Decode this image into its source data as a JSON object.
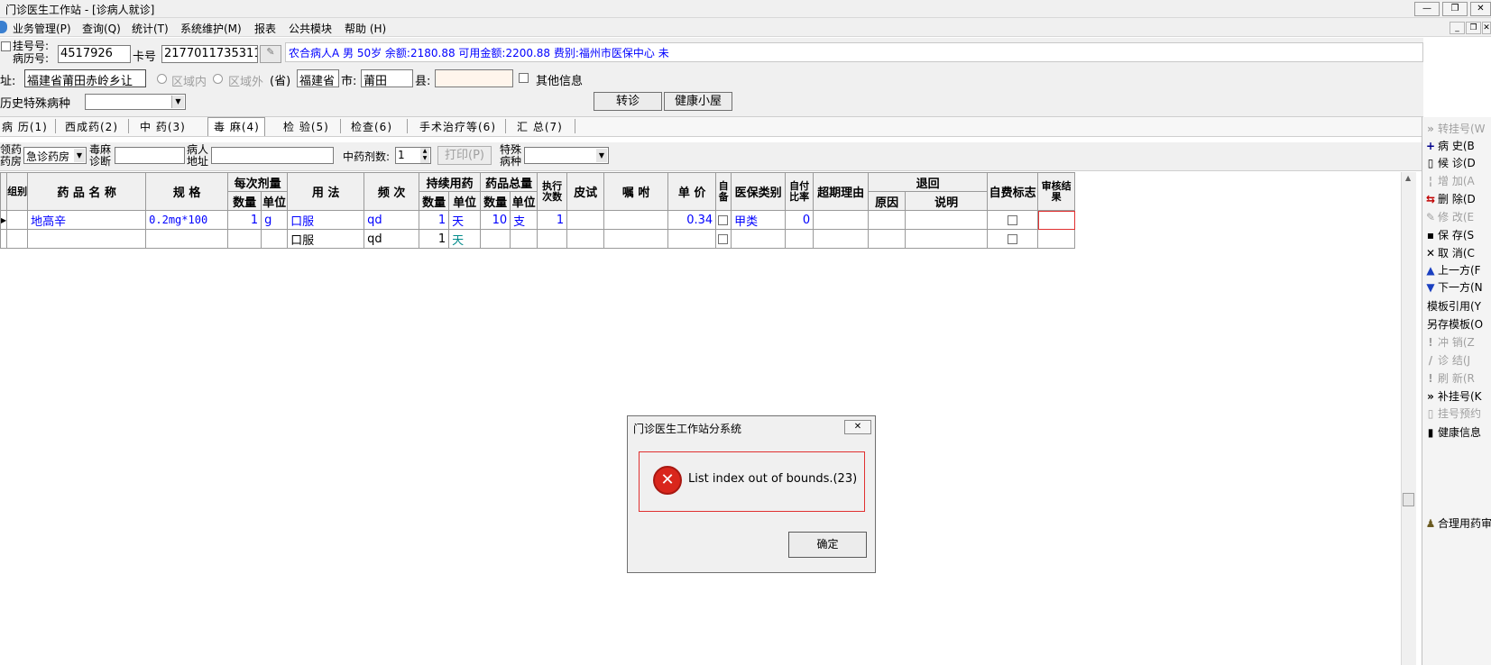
{
  "window": {
    "title": "门诊医生工作站 - [诊病人就诊]",
    "btn_min": "—",
    "btn_restore": "❐",
    "btn_close": "✕"
  },
  "menu": [
    "业务管理(P)",
    "查询(Q)",
    "统计(T)",
    "系统维护(M)",
    "报表",
    "公共模块",
    "帮助 (H)"
  ],
  "mdi": {
    "min": "_",
    "restore": "❐",
    "close": "✕"
  },
  "patient": {
    "reg_no_label": "挂号号:",
    "record_no_label": "病历号:",
    "reg_no": "4517926",
    "card_label": "卡号",
    "card_no": "2177011735311",
    "info": "农合病人A 男 50岁 余额:2180.88 可用金额:2200.88 费别:福州市医保中心 未",
    "addr_label": "址:",
    "addr": "福建省莆田赤岭乡让",
    "in_region": "区域内",
    "out_region": "区域外",
    "prov_label": "(省)",
    "province": "福建省",
    "city_label": "市:",
    "city": "莆田",
    "county_label": "县:",
    "county": "",
    "other_info": "其他信息",
    "history_label": "历史特殊病种",
    "history_value": ""
  },
  "actions": {
    "transfer": "转诊",
    "health": "健康小屋"
  },
  "tabs": [
    "病 历(1)",
    "西成药(2)",
    "中 药(3)",
    "毒 麻(4)",
    "检 验(5)",
    "检查(6)",
    "手术治疗等(6)",
    "汇 总(7)"
  ],
  "filter": {
    "pharmacy_label_1": "领药",
    "pharmacy_label_2": "药房",
    "pharmacy_value": "急诊药房",
    "narcotic_label_1": "毒麻",
    "narcotic_label_2": "诊断",
    "narcotic_value": "",
    "patient_addr_label_1": "病人",
    "patient_addr_label_2": "地址",
    "patient_addr_value": "",
    "doses_label": "中药剂数:",
    "doses_value": "1",
    "print": "打印(P)",
    "special_label_1": "特殊",
    "special_label_2": "病种",
    "special_value": ""
  },
  "grid": {
    "headers": {
      "group": "组别",
      "drug_name": "药 品 名 称",
      "spec": "规 格",
      "per_dose": "每次剂量",
      "qty": "数量",
      "unit": "单位",
      "usage": "用 法",
      "freq": "频 次",
      "continuous": "持续用药",
      "total": "药品总量",
      "exec_times": "执行次数",
      "skin_test": "皮试",
      "note": "嘱 咐",
      "price": "单 价",
      "self_prep": "自备",
      "ins_type": "医保类别",
      "self_pay": "自付比率",
      "over_reason": "超期理由",
      "refund": "退回",
      "refund_reason": "原因",
      "refund_note": "说明",
      "self_flag": "自费标志",
      "audit": "审核结果"
    },
    "rows": [
      {
        "drug_name": "地高辛",
        "spec": "0.2mg*100",
        "dose_qty": "1",
        "dose_unit": "g",
        "usage": "口服",
        "freq": "qd",
        "cont_qty": "1",
        "cont_unit": "天",
        "total_qty": "10",
        "total_unit": "支",
        "exec": "1",
        "price": "0.34",
        "ins_type": "甲类",
        "self_pay": "0"
      },
      {
        "drug_name": "",
        "spec": "",
        "dose_qty": "",
        "dose_unit": "",
        "usage": "口服",
        "freq": "qd",
        "cont_qty": "1",
        "cont_unit": "天",
        "total_qty": "",
        "total_unit": "",
        "exec": "",
        "price": "",
        "ins_type": "",
        "self_pay": ""
      }
    ]
  },
  "sidebar": [
    {
      "label": "转挂号(W",
      "icon": "»",
      "disabled": true
    },
    {
      "label": "病  史(B",
      "icon": "+",
      "disabled": false
    },
    {
      "label": "候  诊(D",
      "icon": "▯",
      "disabled": false
    },
    {
      "label": "增  加(A",
      "icon": "¦",
      "disabled": true
    },
    {
      "label": "删  除(D",
      "icon": "⇆",
      "disabled": false
    },
    {
      "label": "修  改(E",
      "icon": "✎",
      "disabled": true
    },
    {
      "label": "保  存(S",
      "icon": "▪",
      "disabled": false
    },
    {
      "label": "取  消(C",
      "icon": "✕",
      "disabled": false
    },
    {
      "label": "上一方(F",
      "icon": "▲",
      "disabled": false
    },
    {
      "label": "下一方(N",
      "icon": "▼",
      "disabled": false
    },
    {
      "label": "模板引用(Y",
      "icon": "",
      "disabled": false
    },
    {
      "label": "另存模板(O",
      "icon": "",
      "disabled": false
    },
    {
      "label": "冲  销(Z",
      "icon": "!",
      "disabled": true
    },
    {
      "label": "诊  结(J",
      "icon": "/",
      "disabled": true
    },
    {
      "label": "刷  新(R",
      "icon": "!",
      "disabled": true
    },
    {
      "label": "补挂号(K",
      "icon": "»",
      "disabled": false
    },
    {
      "label": "挂号预约",
      "icon": "▯",
      "disabled": true
    },
    {
      "label": "健康信息",
      "icon": "▮",
      "disabled": false
    },
    {
      "label": "合理用药审",
      "icon": "♟",
      "disabled": false
    }
  ],
  "dialog": {
    "title": "门诊医生工作站分系统",
    "close": "✕",
    "message": "List index out of bounds.(23)",
    "ok": "确定"
  },
  "colors": {
    "accent_blue": "#0000ff",
    "error_red": "#d9261c",
    "highlight_border": "#e03030"
  }
}
